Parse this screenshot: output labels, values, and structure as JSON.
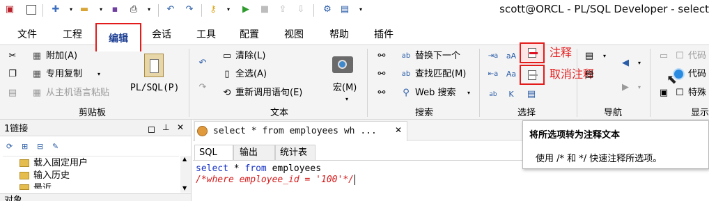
{
  "window": {
    "title": "scott@ORCL - PL/SQL Developer - select"
  },
  "menu_tabs": [
    "文件",
    "工程",
    "编辑",
    "会话",
    "工具",
    "配置",
    "视图",
    "帮助",
    "插件"
  ],
  "ribbon": {
    "clipboard": {
      "label": "剪贴板",
      "append": "附加(A)",
      "special_copy": "专用复制",
      "paste_host": "从主机语言粘贴",
      "plsql": "PL/SQL(P)"
    },
    "text": {
      "label": "文本",
      "clear": "清除(L)",
      "select_all": "全选(A)",
      "recall": "重新调用语句(E)",
      "macro": "宏(M)"
    },
    "search": {
      "label": "搜索",
      "replace_next": "替换下一个",
      "find_match": "查找匹配(M)",
      "web_search": "Web 搜索"
    },
    "selection": {
      "label": "选择",
      "comment": "注释",
      "uncomment": "取消注释"
    },
    "nav": {
      "label": "导航"
    },
    "display": {
      "label": "显示",
      "code1": "代码",
      "code2": "代码",
      "special": "特殊"
    }
  },
  "left_panel": {
    "title": "1链接",
    "items": [
      "载入固定用户",
      "输入历史",
      "最近"
    ],
    "bottom_title": "对象"
  },
  "editor": {
    "doc_tab": "select * from employees wh ...",
    "subtabs": [
      "SQL",
      "输出",
      "统计表"
    ],
    "line1": {
      "kw1": "select",
      "mid": " * ",
      "kw2": "from",
      "rest": " employees"
    },
    "line2": "/*where employee_id = '100'*/"
  },
  "tooltip": {
    "title": "将所选项转为注释文本",
    "body": "使用 /* 和 */ 快速注释所选项。"
  },
  "colors": {
    "accent": "#1c3e93",
    "highlight": "#e41b1b",
    "keyword": "#1a35c6",
    "comment": "#d51a1a"
  }
}
